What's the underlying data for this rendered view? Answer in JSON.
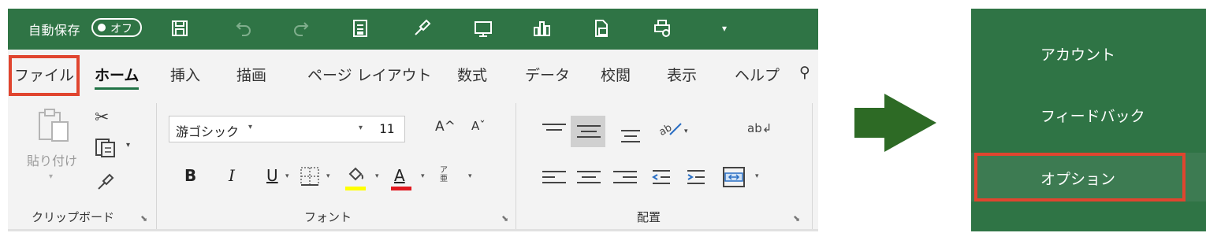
{
  "qat": {
    "autosave_label": "自動保存",
    "toggle_label": "オフ",
    "icons": [
      "save-icon",
      "undo-icon",
      "redo-icon",
      "form-icon",
      "format-painter-icon",
      "screenshot-icon",
      "chart-icon",
      "pdf-icon",
      "print-preview-icon",
      "customize-dropdown-icon"
    ]
  },
  "tabs": [
    {
      "label": "ファイル"
    },
    {
      "label": "ホーム"
    },
    {
      "label": "挿入"
    },
    {
      "label": "描画"
    },
    {
      "label": "ページ レイアウト"
    },
    {
      "label": "数式"
    },
    {
      "label": "データ"
    },
    {
      "label": "校閲"
    },
    {
      "label": "表示"
    },
    {
      "label": "ヘルプ"
    }
  ],
  "ribbon": {
    "clipboard": {
      "paste_label": "貼り付け",
      "group_label": "クリップボード"
    },
    "font": {
      "font_name": "游ゴシック",
      "font_size": "11",
      "bold": "B",
      "italic": "I",
      "underline": "U",
      "font_color_glyph": "A",
      "phonetic_glyph": "ア亜",
      "grow_glyph": "A^",
      "shrink_glyph": "Aˇ",
      "group_label": "フォント",
      "fill_color": "#ffff00",
      "font_color": "#e0181f"
    },
    "alignment": {
      "wrap_glyph": "ab↲",
      "group_label": "配置"
    }
  },
  "backstage": {
    "items": [
      {
        "label": "アカウント"
      },
      {
        "label": "フィードバック"
      },
      {
        "label": "オプション"
      }
    ]
  },
  "colors": {
    "excel_green": "#2f7445",
    "highlight_red": "#e0452f",
    "arrow_green": "#2d6a25"
  }
}
